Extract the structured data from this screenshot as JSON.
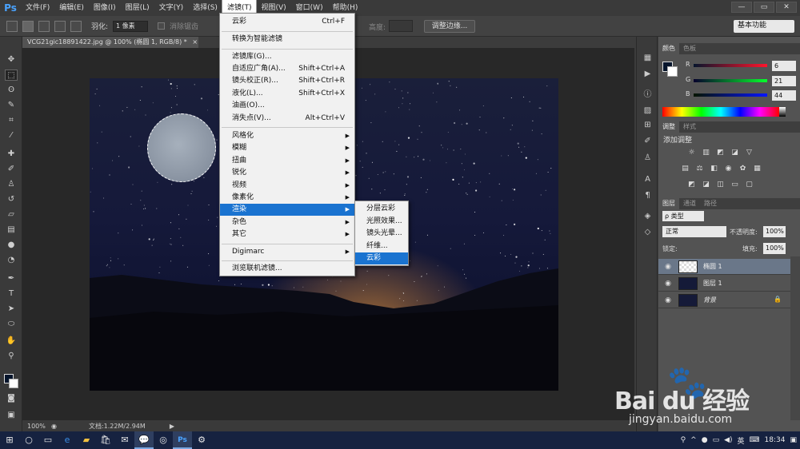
{
  "app": {
    "logo": "Ps"
  },
  "menubar": {
    "items": [
      "文件(F)",
      "编辑(E)",
      "图像(I)",
      "图层(L)",
      "文字(Y)",
      "选择(S)",
      "滤镜(T)",
      "视图(V)",
      "窗口(W)",
      "帮助(H)"
    ],
    "active_index": 6
  },
  "window_controls": {
    "minimize": "—",
    "maximize": "▭",
    "close": "✕"
  },
  "options_bar": {
    "feather_label": "羽化:",
    "feather_value": "1 像素",
    "antialias_label": "消除锯齿",
    "height_label": "高度:",
    "refine_edge_label": "调整边缘...",
    "workspace": "基本功能"
  },
  "document": {
    "tab_title": "VCG21gic18891422.jpg @ 100% (椭圆 1, RGB/8) *",
    "tab_close": "×",
    "zoom": "100%",
    "doc_size": "文档:1.22M/2.94M"
  },
  "filter_menu": {
    "items": [
      {
        "label": "云彩",
        "shortcut": "Ctrl+F"
      },
      {
        "label": "转换为智能滤镜"
      },
      {
        "label": "滤镜库(G)..."
      },
      {
        "label": "自适应广角(A)...",
        "shortcut": "Shift+Ctrl+A"
      },
      {
        "label": "镜头校正(R)...",
        "shortcut": "Shift+Ctrl+R"
      },
      {
        "label": "液化(L)...",
        "shortcut": "Shift+Ctrl+X"
      },
      {
        "label": "油画(O)..."
      },
      {
        "label": "消失点(V)...",
        "shortcut": "Alt+Ctrl+V"
      },
      {
        "label": "风格化",
        "submenu": true
      },
      {
        "label": "模糊",
        "submenu": true
      },
      {
        "label": "扭曲",
        "submenu": true
      },
      {
        "label": "锐化",
        "submenu": true
      },
      {
        "label": "视频",
        "submenu": true
      },
      {
        "label": "像素化",
        "submenu": true
      },
      {
        "label": "渲染",
        "submenu": true,
        "highlighted": true
      },
      {
        "label": "杂色",
        "submenu": true
      },
      {
        "label": "其它",
        "submenu": true
      },
      {
        "label": "Digimarc",
        "submenu": true
      },
      {
        "label": "浏览联机滤镜..."
      }
    ]
  },
  "render_submenu": {
    "items": [
      {
        "label": "分层云彩"
      },
      {
        "label": "光照效果..."
      },
      {
        "label": "镜头光晕..."
      },
      {
        "label": "纤维..."
      },
      {
        "label": "云彩",
        "highlighted": true
      }
    ]
  },
  "color_panel": {
    "tabs": [
      "颜色",
      "色板"
    ],
    "r": "6",
    "g": "21",
    "b": "44",
    "fg_color": "#06152c",
    "bg_color": "#ffffff"
  },
  "adjust_panel": {
    "tabs": [
      "调整",
      "样式"
    ],
    "title": "添加调整"
  },
  "layers_panel": {
    "tabs": [
      "图层",
      "通道",
      "路径"
    ],
    "filter": "ρ 类型",
    "blend_mode": "正常",
    "opacity_label": "不透明度:",
    "opacity": "100%",
    "lock_label": "锁定:",
    "fill_label": "填充:",
    "fill": "100%",
    "layers": [
      {
        "name": "椭圆 1",
        "selected": true
      },
      {
        "name": "图层 1",
        "selected": false
      },
      {
        "name": "背景",
        "selected": false,
        "locked": true
      }
    ]
  },
  "watermark": {
    "brand": "Bai du 经验",
    "url": "jingyan.baidu.com"
  },
  "taskbar": {
    "tray_ime": "英",
    "time": "18:34"
  }
}
